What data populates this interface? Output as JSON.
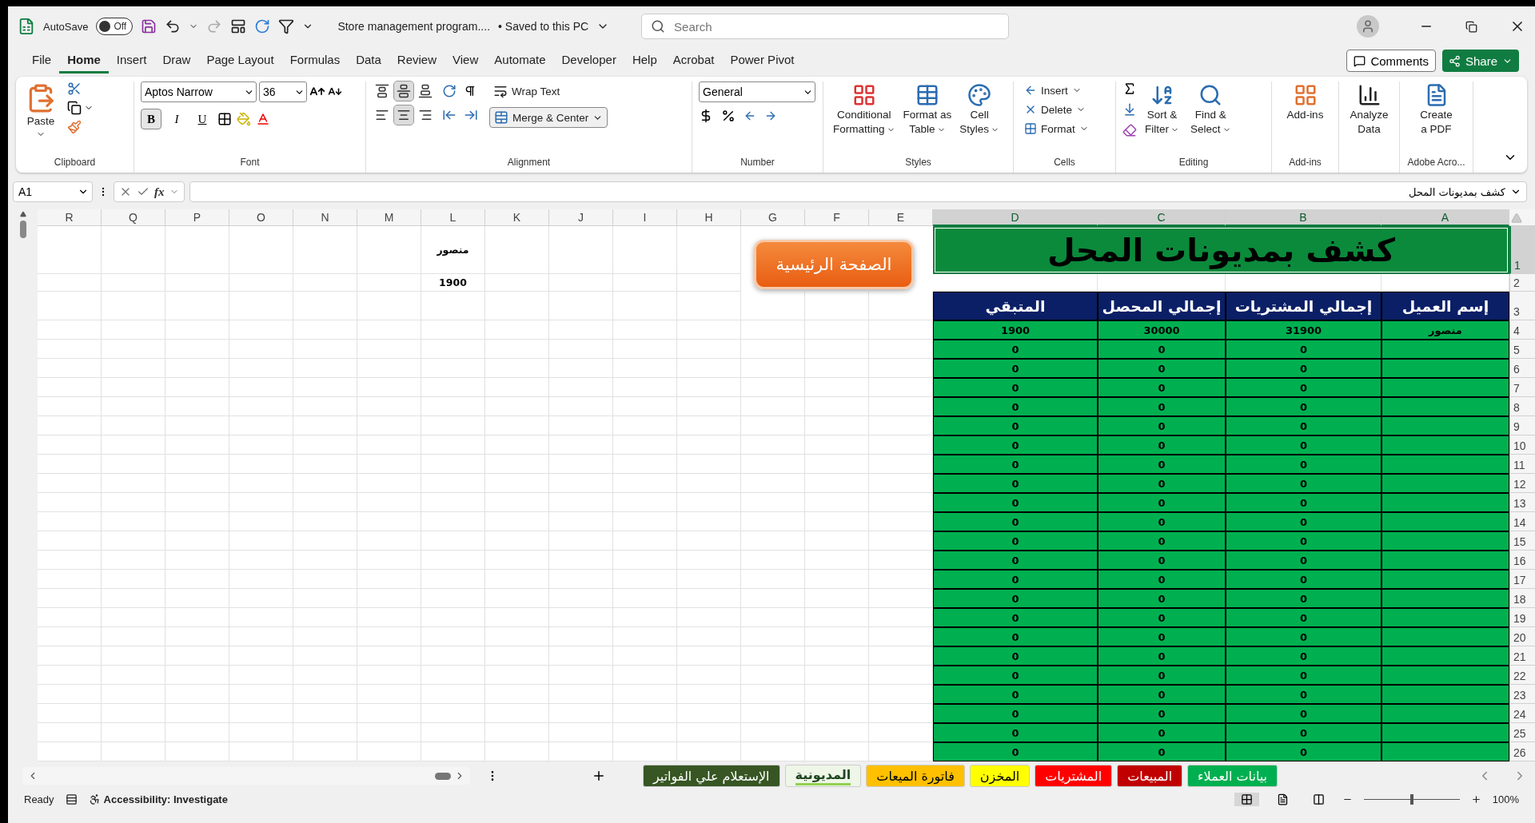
{
  "title_bar": {
    "autosave_label": "AutoSave",
    "autosave": {
      "on": false,
      "text": "Off"
    },
    "redo_disabled": true,
    "document": "Store management program....",
    "save_state": "• Saved to this PC",
    "search": {
      "placeholder": "Search"
    }
  },
  "menu_tabs": [
    {
      "label": "File",
      "selected": false
    },
    {
      "label": "Home",
      "selected": true
    },
    {
      "label": "Insert",
      "selected": false
    },
    {
      "label": "Draw",
      "selected": false
    },
    {
      "label": "Page Layout",
      "selected": false
    },
    {
      "label": "Formulas",
      "selected": false
    },
    {
      "label": "Data",
      "selected": false
    },
    {
      "label": "Review",
      "selected": false
    },
    {
      "label": "View",
      "selected": false
    },
    {
      "label": "Automate",
      "selected": false
    },
    {
      "label": "Developer",
      "selected": false
    },
    {
      "label": "Help",
      "selected": false
    },
    {
      "label": "Acrobat",
      "selected": false
    },
    {
      "label": "Power Pivot",
      "selected": false
    }
  ],
  "comments_button": "Comments",
  "share_button": "Share",
  "ribbon": {
    "clipboard": {
      "paste": "Paste",
      "label": "Clipboard"
    },
    "font": {
      "font_name": "Aptos Narrow",
      "font_size": "36",
      "bold": {
        "text": "B",
        "selected": true
      },
      "italic": {
        "text": "I",
        "selected": false
      },
      "underline": {
        "text": "U",
        "selected": false
      },
      "label": "Font"
    },
    "alignment": {
      "vertical": [
        {
          "selected": false
        },
        {
          "selected": true
        },
        {
          "selected": false
        }
      ],
      "horizontal": [
        {
          "selected": false
        },
        {
          "selected": true
        },
        {
          "selected": false
        }
      ],
      "wrap_text": "Wrap Text",
      "merge_center": "Merge & Center",
      "label": "Alignment"
    },
    "number": {
      "format": "General",
      "label": "Number"
    },
    "styles": {
      "buttons": [
        [
          "Conditional",
          "Formatting"
        ],
        [
          "Format as",
          "Table"
        ],
        [
          "Cell",
          "Styles"
        ]
      ],
      "label": "Styles"
    },
    "cells": {
      "buttons": [
        "Insert",
        "Delete",
        "Format"
      ],
      "label": "Cells"
    },
    "editing": {
      "buttons": [
        [
          "Sort &",
          "Filter"
        ],
        [
          "Find &",
          "Select"
        ]
      ],
      "label": "Editing"
    },
    "addins": {
      "button": "Add-ins",
      "label": "Add-ins"
    },
    "analyze": {
      "lines": [
        "Analyze",
        "Data"
      ]
    },
    "adobe": {
      "lines": [
        "Create",
        "a PDF"
      ],
      "label": "Adobe Acro..."
    }
  },
  "formula_bar": {
    "name_box": "A1",
    "fx": "fx",
    "value": "كشف بمديونات المحل"
  },
  "sheet": {
    "columns": [
      {
        "label": "R",
        "selected": false
      },
      {
        "label": "Q",
        "selected": false
      },
      {
        "label": "P",
        "selected": false
      },
      {
        "label": "O",
        "selected": false
      },
      {
        "label": "N",
        "selected": false
      },
      {
        "label": "M",
        "selected": false
      },
      {
        "label": "L",
        "selected": false
      },
      {
        "label": "K",
        "selected": false
      },
      {
        "label": "J",
        "selected": false
      },
      {
        "label": "I",
        "selected": false
      },
      {
        "label": "H",
        "selected": false
      },
      {
        "label": "G",
        "selected": false
      },
      {
        "label": "F",
        "selected": false
      },
      {
        "label": "E",
        "selected": false
      },
      {
        "label": "D",
        "selected": true
      },
      {
        "label": "C",
        "selected": true
      },
      {
        "label": "B",
        "selected": true
      },
      {
        "label": "A",
        "selected": true
      }
    ],
    "row_numbers": [
      {
        "label": "1",
        "selected": true
      },
      {
        "label": "2",
        "selected": false
      },
      {
        "label": "3",
        "selected": false
      },
      {
        "label": "4",
        "selected": false
      },
      {
        "label": "5",
        "selected": false
      },
      {
        "label": "6",
        "selected": false
      },
      {
        "label": "7",
        "selected": false
      },
      {
        "label": "8",
        "selected": false
      },
      {
        "label": "9",
        "selected": false
      },
      {
        "label": "10",
        "selected": false
      },
      {
        "label": "11",
        "selected": false
      },
      {
        "label": "12",
        "selected": false
      },
      {
        "label": "13",
        "selected": false
      },
      {
        "label": "14",
        "selected": false
      },
      {
        "label": "15",
        "selected": false
      },
      {
        "label": "16",
        "selected": false
      },
      {
        "label": "17",
        "selected": false
      },
      {
        "label": "18",
        "selected": false
      },
      {
        "label": "19",
        "selected": false
      },
      {
        "label": "20",
        "selected": false
      },
      {
        "label": "21",
        "selected": false
      },
      {
        "label": "22",
        "selected": false
      },
      {
        "label": "23",
        "selected": false
      },
      {
        "label": "24",
        "selected": false
      },
      {
        "label": "25",
        "selected": false
      },
      {
        "label": "26",
        "selected": false
      }
    ],
    "side_cells": {
      "name": "منصور",
      "remaining": "1900"
    },
    "home_button": "الصفحة الرئيسية",
    "report": {
      "title": "كشف بمديونات المحل",
      "headers": [
        "إسم العميل",
        "إجمالي المشتريات",
        "إجمالي المحصل",
        "المتبقي"
      ],
      "rows": [
        {
          "customer": "منصور",
          "purchases": "31900",
          "collected": "30000",
          "remaining": "1900"
        },
        {
          "purchases": "0",
          "collected": "0",
          "remaining": "0"
        },
        {
          "purchases": "0",
          "collected": "0",
          "remaining": "0"
        },
        {
          "purchases": "0",
          "collected": "0",
          "remaining": "0"
        },
        {
          "purchases": "0",
          "collected": "0",
          "remaining": "0"
        },
        {
          "purchases": "0",
          "collected": "0",
          "remaining": "0"
        },
        {
          "purchases": "0",
          "collected": "0",
          "remaining": "0"
        },
        {
          "purchases": "0",
          "collected": "0",
          "remaining": "0"
        },
        {
          "purchases": "0",
          "collected": "0",
          "remaining": "0"
        },
        {
          "purchases": "0",
          "collected": "0",
          "remaining": "0"
        },
        {
          "purchases": "0",
          "collected": "0",
          "remaining": "0"
        },
        {
          "purchases": "0",
          "collected": "0",
          "remaining": "0"
        },
        {
          "purchases": "0",
          "collected": "0",
          "remaining": "0"
        },
        {
          "purchases": "0",
          "collected": "0",
          "remaining": "0"
        },
        {
          "purchases": "0",
          "collected": "0",
          "remaining": "0"
        },
        {
          "purchases": "0",
          "collected": "0",
          "remaining": "0"
        },
        {
          "purchases": "0",
          "collected": "0",
          "remaining": "0"
        },
        {
          "purchases": "0",
          "collected": "0",
          "remaining": "0"
        },
        {
          "purchases": "0",
          "collected": "0",
          "remaining": "0"
        },
        {
          "purchases": "0",
          "collected": "0",
          "remaining": "0"
        },
        {
          "purchases": "0",
          "collected": "0",
          "remaining": "0"
        },
        {
          "purchases": "0",
          "collected": "0",
          "remaining": "0"
        },
        {
          "purchases": "0",
          "collected": "0",
          "remaining": "0"
        }
      ]
    }
  },
  "sheet_tabs": [
    {
      "label": "بيانات العملاء",
      "color": "#00b050",
      "selected": false
    },
    {
      "label": "المبيعات",
      "color": "#c00000",
      "selected": false
    },
    {
      "label": "المشتريات",
      "color": "#ff0000",
      "selected": false
    },
    {
      "label": "المخزن",
      "color": "#ffff00",
      "selected": false
    },
    {
      "label": "فاتورة الميعات",
      "color": "#ffc000",
      "selected": false
    },
    {
      "label": "المديونية",
      "color": "#92d050",
      "selected": true
    },
    {
      "label": "الإستعلام علي الفواتير",
      "color": "#375623",
      "selected": false
    }
  ],
  "status_bar": {
    "ready": "Ready",
    "accessibility": "Accessibility: Investigate",
    "view": [
      {
        "selected": true
      },
      {
        "selected": false
      },
      {
        "selected": false
      }
    ],
    "zoom": {
      "level": 0.5,
      "text": "100%"
    }
  }
}
